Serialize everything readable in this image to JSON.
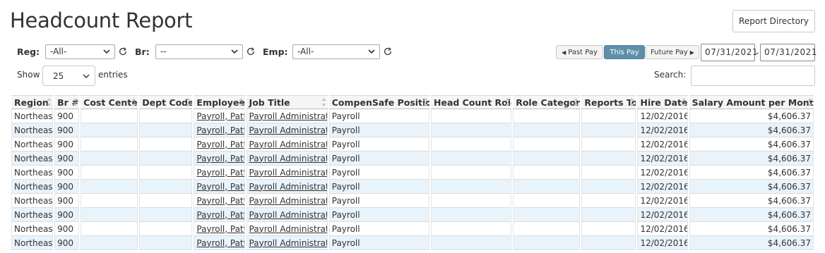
{
  "page": {
    "title": "Headcount Report",
    "report_directory_label": "Report Directory"
  },
  "filters": {
    "region": {
      "label": "Reg:",
      "value": "-All-"
    },
    "branch": {
      "label": "Br:",
      "value": "--"
    },
    "employee": {
      "label": "Emp:",
      "value": "-All-"
    }
  },
  "pay_nav": {
    "past_label": "Past Pay",
    "this_label": "This Pay",
    "future_label": "Future Pay",
    "start_date": "07/31/2021",
    "end_date": "07/31/2021",
    "separator": "-"
  },
  "table_controls": {
    "show_label": "Show",
    "page_length": "25",
    "entries_label": "entries",
    "search_label": "Search:",
    "search_value": ""
  },
  "colors": {
    "accent_active": "#5f8fa8",
    "row_stripe": "#e8f3fb"
  },
  "table": {
    "columns": [
      "Region",
      "Br #",
      "Cost Center",
      "Dept Code",
      "Employee",
      "Job Title",
      "CompenSafe Position",
      "Head Count Role",
      "Role Category",
      "Reports To",
      "Hire Date",
      "Salary Amount per Month"
    ],
    "rows": [
      [
        "Northeast",
        "900",
        "",
        "",
        "Payroll, Patti",
        "Payroll Administrator",
        "Payroll",
        "",
        "",
        "",
        "12/02/2016",
        "$4,606.37"
      ],
      [
        "Northeast",
        "900",
        "",
        "",
        "Payroll, Patti",
        "Payroll Administrator",
        "Payroll",
        "",
        "",
        "",
        "12/02/2016",
        "$4,606.37"
      ],
      [
        "Northeast",
        "900",
        "",
        "",
        "Payroll, Patti",
        "Payroll Administrator",
        "Payroll",
        "",
        "",
        "",
        "12/02/2016",
        "$4,606.37"
      ],
      [
        "Northeast",
        "900",
        "",
        "",
        "Payroll, Patti",
        "Payroll Administrator",
        "Payroll",
        "",
        "",
        "",
        "12/02/2016",
        "$4,606.37"
      ],
      [
        "Northeast",
        "900",
        "",
        "",
        "Payroll, Patti",
        "Payroll Administrator",
        "Payroll",
        "",
        "",
        "",
        "12/02/2016",
        "$4,606.37"
      ],
      [
        "Northeast",
        "900",
        "",
        "",
        "Payroll, Patti",
        "Payroll Administrator",
        "Payroll",
        "",
        "",
        "",
        "12/02/2016",
        "$4,606.37"
      ],
      [
        "Northeast",
        "900",
        "",
        "",
        "Payroll, Patti",
        "Payroll Administrator",
        "Payroll",
        "",
        "",
        "",
        "12/02/2016",
        "$4,606.37"
      ],
      [
        "Northeast",
        "900",
        "",
        "",
        "Payroll, Patti",
        "Payroll Administrator",
        "Payroll",
        "",
        "",
        "",
        "12/02/2016",
        "$4,606.37"
      ],
      [
        "Northeast",
        "900",
        "",
        "",
        "Payroll, Patti",
        "Payroll Administrator",
        "Payroll",
        "",
        "",
        "",
        "12/02/2016",
        "$4,606.37"
      ],
      [
        "Northeast",
        "900",
        "",
        "",
        "Payroll, Patti",
        "Payroll Administrator",
        "Payroll",
        "",
        "",
        "",
        "12/02/2016",
        "$4,606.37"
      ]
    ]
  }
}
